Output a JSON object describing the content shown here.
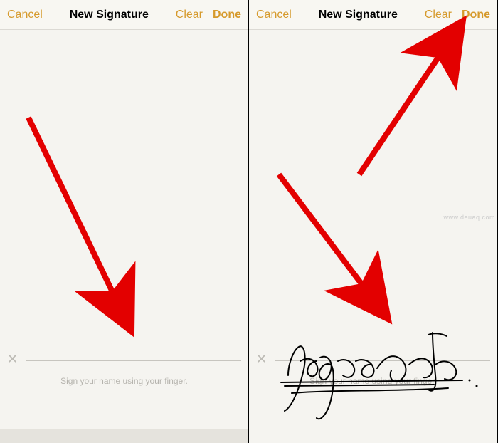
{
  "panels": [
    {
      "header": {
        "cancel": "Cancel",
        "title": "New Signature",
        "clear": "Clear",
        "done": "Done"
      },
      "hint": "Sign your name using your finger.",
      "has_signature": false
    },
    {
      "header": {
        "cancel": "Cancel",
        "title": "New Signature",
        "clear": "Clear",
        "done": "Done"
      },
      "hint": "Sign your name using your finger.",
      "has_signature": true
    }
  ],
  "watermark": "www.deuaq.com"
}
